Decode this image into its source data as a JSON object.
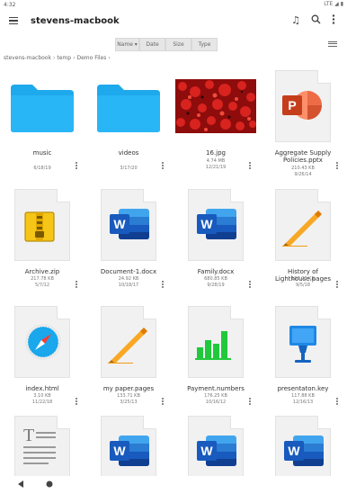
{
  "status": {
    "time": "4:32",
    "right": "LTE ◢ ▮"
  },
  "appbar": {
    "title": "stevens-macbook"
  },
  "sort": {
    "name": "Name",
    "date": "Date",
    "size": "Size",
    "type": "Type"
  },
  "breadcrumb": [
    "stevens-macbook",
    "temp",
    "Demo Files"
  ],
  "files": [
    {
      "name": "music",
      "size": "",
      "date": "6/18/19",
      "kind": "folder"
    },
    {
      "name": "videos",
      "size": "",
      "date": "3/17/20",
      "kind": "folder"
    },
    {
      "name": "16.jpg",
      "size": "4.74 MB",
      "date": "12/21/19",
      "kind": "image"
    },
    {
      "name": "Aggregate Supply Policies.pptx",
      "size": "210.43 KB",
      "date": "9/26/14",
      "kind": "pptx"
    },
    {
      "name": "Archive.zip",
      "size": "217.78 KB",
      "date": "5/7/12",
      "kind": "zip"
    },
    {
      "name": "Document-1.docx",
      "size": "24.92 KB",
      "date": "10/18/17",
      "kind": "docx"
    },
    {
      "name": "Family.docx",
      "size": "680.85 KB",
      "date": "9/28/19",
      "kind": "docx"
    },
    {
      "name": "History of Lighthouse.pages",
      "size": "188.20 KB",
      "date": "9/5/18",
      "kind": "pages"
    },
    {
      "name": "index.html",
      "size": "3.10 KB",
      "date": "11/22/18",
      "kind": "html"
    },
    {
      "name": "my paper.pages",
      "size": "133.71 KB",
      "date": "3/25/13",
      "kind": "pages"
    },
    {
      "name": "Payment.numbers",
      "size": "176.25 KB",
      "date": "10/16/12",
      "kind": "numbers"
    },
    {
      "name": "presentaton.key",
      "size": "117.88 KB",
      "date": "12/16/13",
      "kind": "key"
    },
    {
      "name": "",
      "size": "",
      "date": "",
      "kind": "text"
    },
    {
      "name": "",
      "size": "",
      "date": "",
      "kind": "docx"
    },
    {
      "name": "",
      "size": "",
      "date": "",
      "kind": "docx"
    },
    {
      "name": "",
      "size": "",
      "date": "",
      "kind": "docx"
    }
  ],
  "colors": {
    "folder": "#29b6f6",
    "word": "#2b579a",
    "pptx": "#d04423",
    "pages": "#f39c12",
    "numbers": "#1fc93b",
    "keynote": "#1e88e5"
  }
}
